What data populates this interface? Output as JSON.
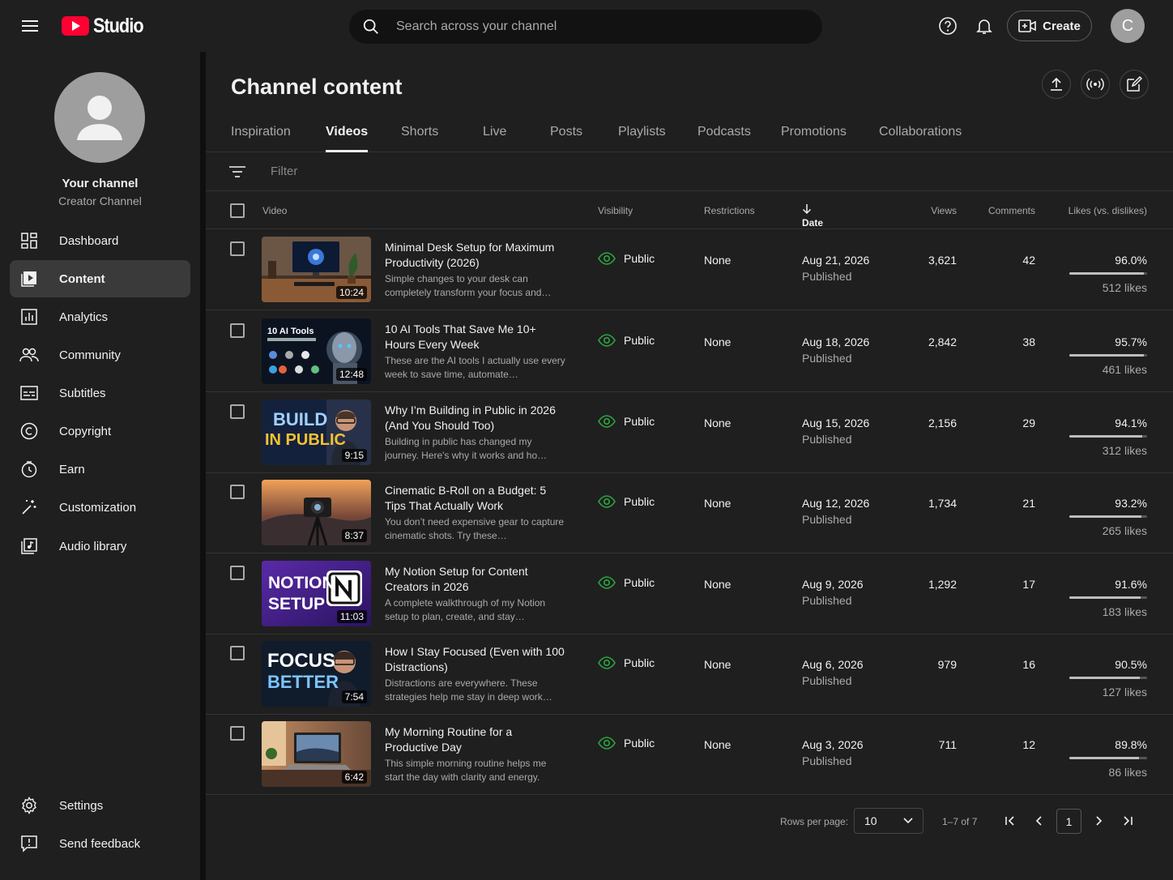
{
  "app": {
    "logo_word": "Studio"
  },
  "topbar": {
    "search_placeholder": "Search across your channel",
    "create_label": "Create",
    "avatar_letter": "C"
  },
  "channel": {
    "name": "Your channel",
    "subtitle": "Creator Channel"
  },
  "sidebar": {
    "items": [
      {
        "label": "Dashboard",
        "icon": "dashboard-icon"
      },
      {
        "label": "Content",
        "icon": "content-icon",
        "active": true
      },
      {
        "label": "Analytics",
        "icon": "analytics-icon"
      },
      {
        "label": "Community",
        "icon": "community-icon"
      },
      {
        "label": "Subtitles",
        "icon": "subtitles-icon"
      },
      {
        "label": "Copyright",
        "icon": "copyright-icon"
      },
      {
        "label": "Earn",
        "icon": "earn-icon"
      },
      {
        "label": "Customization",
        "icon": "customization-icon"
      },
      {
        "label": "Audio library",
        "icon": "audio-library-icon"
      }
    ],
    "footer": [
      {
        "label": "Settings",
        "icon": "gear-icon"
      },
      {
        "label": "Send feedback",
        "icon": "feedback-icon"
      }
    ]
  },
  "main": {
    "title": "Channel content",
    "tabs": [
      {
        "label": "Inspiration"
      },
      {
        "label": "Videos",
        "active": true
      },
      {
        "label": "Shorts"
      },
      {
        "label": "Live"
      },
      {
        "label": "Posts"
      },
      {
        "label": "Playlists"
      },
      {
        "label": "Podcasts"
      },
      {
        "label": "Promotions"
      },
      {
        "label": "Collaborations"
      }
    ],
    "filter_placeholder": "Filter",
    "columns": {
      "video": "Video",
      "visibility": "Visibility",
      "restrictions": "Restrictions",
      "date": "Date",
      "views": "Views",
      "comments": "Comments",
      "likes": "Likes (vs. dislikes)"
    },
    "videos": [
      {
        "title": "Minimal Desk Setup for Maximum Productivity (2026)",
        "description": "Simple changes to your desk can completely transform your focus and…",
        "duration": "10:24",
        "visibility": "Public",
        "restrictions": "None",
        "date": "Aug 21, 2026",
        "status": "Published",
        "views": "3,621",
        "comments": "42",
        "likes_pct": "96.0%",
        "likes_fraction": 0.96,
        "likes": "512 likes"
      },
      {
        "title": "10 AI Tools That Save Me 10+ Hours Every Week",
        "description": "These are the AI tools I actually use every week to save time, automate…",
        "duration": "12:48",
        "visibility": "Public",
        "restrictions": "None",
        "date": "Aug 18, 2026",
        "status": "Published",
        "views": "2,842",
        "comments": "38",
        "likes_pct": "95.7%",
        "likes_fraction": 0.957,
        "likes": "461 likes",
        "thumb_text": "10 AI Tools"
      },
      {
        "title": "Why I’m Building in Public in 2026 (And You Should Too)",
        "description": "Building in public has changed my journey. Here's why it works and ho…",
        "duration": "9:15",
        "visibility": "Public",
        "restrictions": "None",
        "date": "Aug 15, 2026",
        "status": "Published",
        "views": "2,156",
        "comments": "29",
        "likes_pct": "94.1%",
        "likes_fraction": 0.941,
        "likes": "312 likes",
        "thumb_line1": "BUILD",
        "thumb_line2": "IN PUBLIC"
      },
      {
        "title": "Cinematic B-Roll on a Budget: 5 Tips That Actually Work",
        "description": "You don’t need expensive gear to capture cinematic shots. Try these…",
        "duration": "8:37",
        "visibility": "Public",
        "restrictions": "None",
        "date": "Aug 12, 2026",
        "status": "Published",
        "views": "1,734",
        "comments": "21",
        "likes_pct": "93.2%",
        "likes_fraction": 0.932,
        "likes": "265 likes"
      },
      {
        "title": "My Notion Setup for Content Creators in 2026",
        "description": "A complete walkthrough of my Notion setup to plan, create, and stay…",
        "duration": "11:03",
        "visibility": "Public",
        "restrictions": "None",
        "date": "Aug 9, 2026",
        "status": "Published",
        "views": "1,292",
        "comments": "17",
        "likes_pct": "91.6%",
        "likes_fraction": 0.916,
        "likes": "183 likes",
        "thumb_line1": "NOTION",
        "thumb_line2": "SETUP"
      },
      {
        "title": "How I Stay Focused (Even with 100 Distractions)",
        "description": "Distractions are everywhere. These strategies help me stay in deep work…",
        "duration": "7:54",
        "visibility": "Public",
        "restrictions": "None",
        "date": "Aug 6, 2026",
        "status": "Published",
        "views": "979",
        "comments": "16",
        "likes_pct": "90.5%",
        "likes_fraction": 0.905,
        "likes": "127 likes",
        "thumb_line1": "FOCUS",
        "thumb_line2": "BETTER"
      },
      {
        "title": "My Morning Routine for a Productive Day",
        "description": "This simple morning routine helps me start the day with clarity and energy.",
        "duration": "6:42",
        "visibility": "Public",
        "restrictions": "None",
        "date": "Aug 3, 2026",
        "status": "Published",
        "views": "711",
        "comments": "12",
        "likes_pct": "89.8%",
        "likes_fraction": 0.898,
        "likes": "86 likes"
      }
    ],
    "pagination": {
      "rows_label": "Rows per page:",
      "rows_value": "10",
      "range": "1–7 of 7",
      "page": "1"
    }
  },
  "colors": {
    "brand_red": "#ff0033",
    "background": "#1f1f1f",
    "visibility_green": "#2ba640"
  }
}
